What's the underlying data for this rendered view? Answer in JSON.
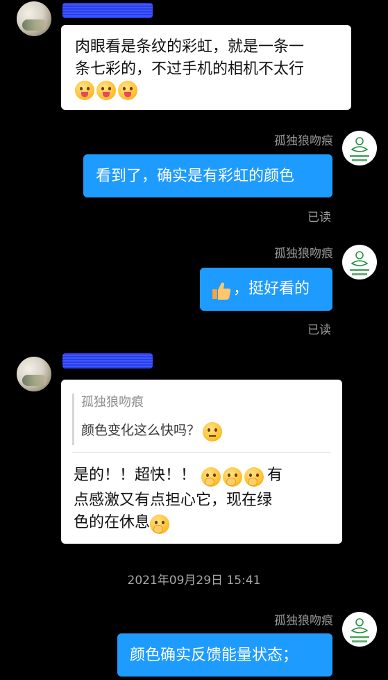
{
  "messages": {
    "m1_text_line1": "肉眼看是条纹的彩虹，就是一条一",
    "m1_text_line2": "条七彩的，不过手机的相机不太行",
    "self_name": "孤独狼吻痕",
    "m2_text": "看到了，确实是有彩虹的颜色",
    "read_label": "已读",
    "m3_text": "，挺好看的",
    "quote_name": "孤独狼吻痕",
    "quote_text": "颜色变化这么快吗？",
    "m4_line1": "是的！！超快！！",
    "m4_line1_tail": "有",
    "m4_line2": "点感激又有点担心它，现在绿",
    "m4_line3": "色的在休息",
    "timestamp": "2021年09月29日 15:41",
    "m5_text": "颜色确实反馈能量状态；"
  },
  "icons": {
    "tongue": "face-with-tongue-icon",
    "hand_over_mouth": "face-with-hand-over-mouth-icon",
    "thinking": "face-with-raised-eyebrow-icon",
    "thumbs_up": "thumbs-up-icon"
  },
  "colors": {
    "background": "#000000",
    "outgoing_bubble": "#1e9bff",
    "incoming_bubble": "#ffffff",
    "meta_text": "#9a9a9a"
  }
}
